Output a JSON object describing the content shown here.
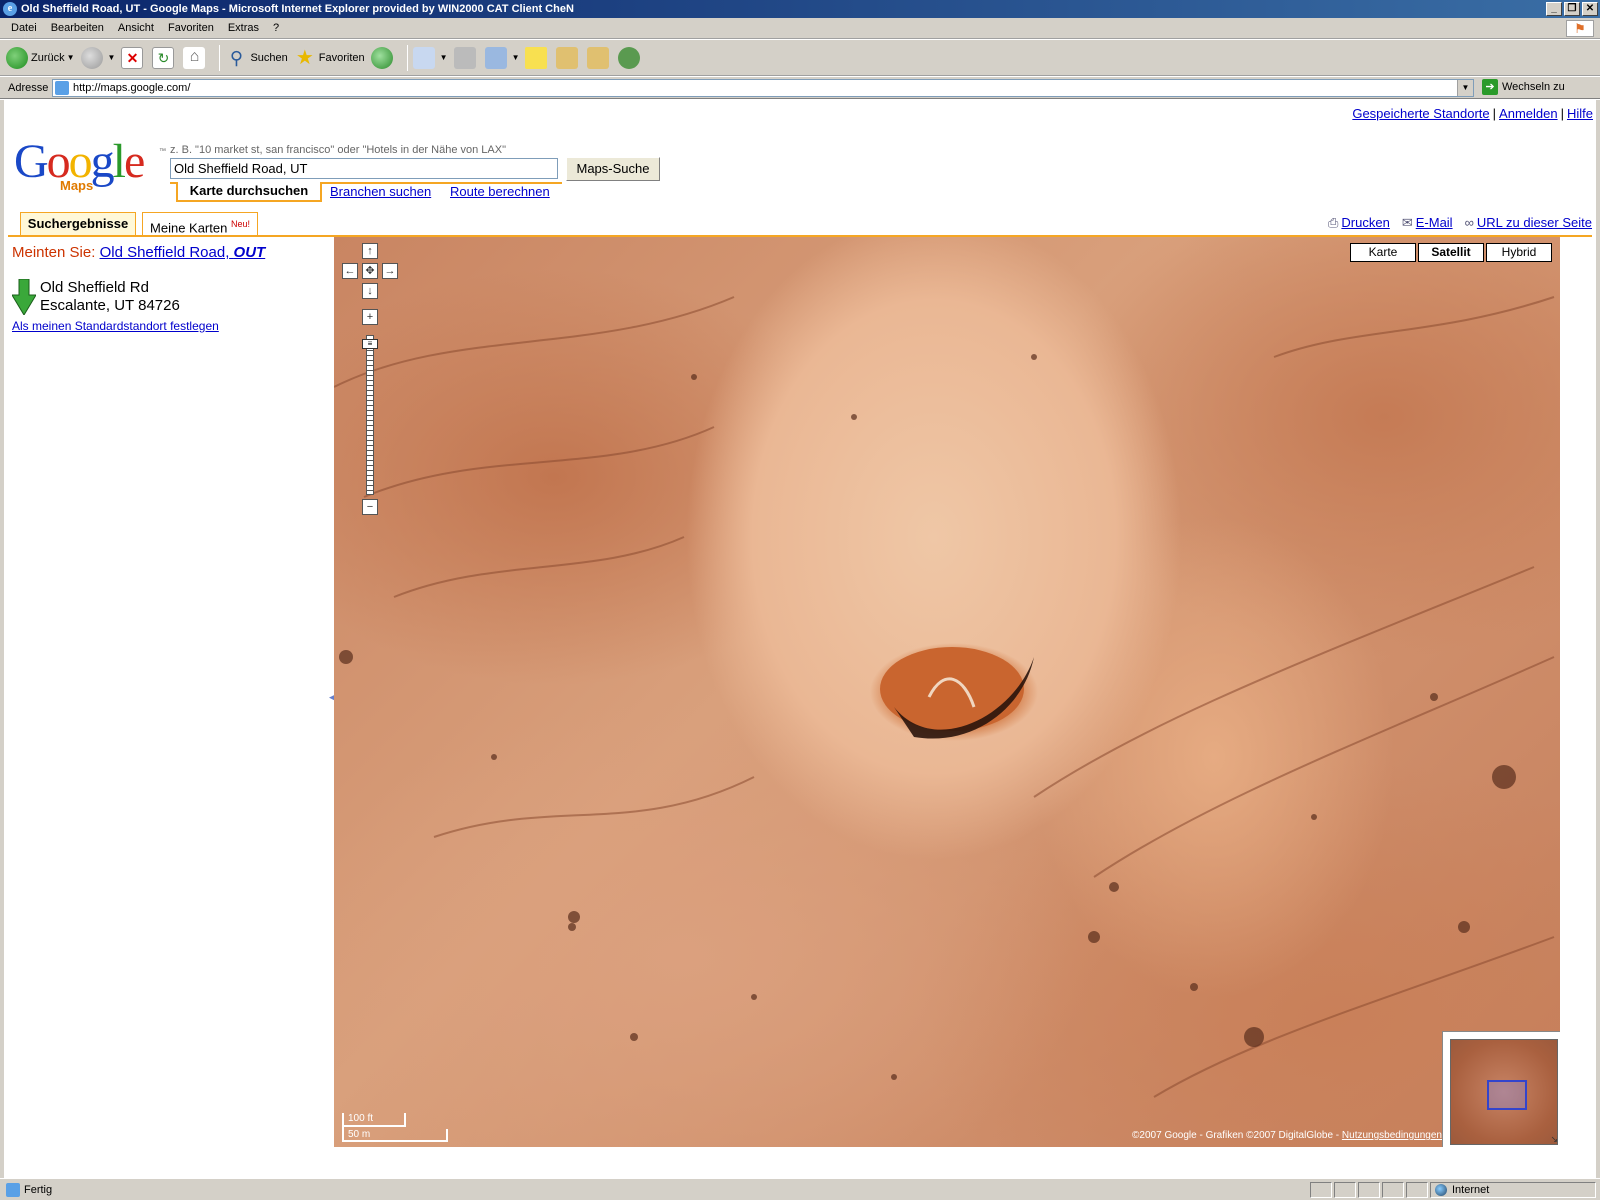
{
  "window": {
    "title": "Old Sheffield Road, UT - Google Maps - Microsoft Internet Explorer provided by WIN2000 CAT Client CheN"
  },
  "menu": [
    "Datei",
    "Bearbeiten",
    "Ansicht",
    "Favoriten",
    "Extras",
    "?"
  ],
  "toolbar": {
    "back_label": "Zurück",
    "search_label": "Suchen",
    "favorites_label": "Favoriten"
  },
  "address": {
    "label": "Adresse",
    "url": "http://maps.google.com/",
    "go_label": "Wechseln zu"
  },
  "toplinks": {
    "saved": "Gespeicherte Standorte",
    "signin": "Anmelden",
    "help": "Hilfe"
  },
  "logo": {
    "text": "Google",
    "sub": "Maps"
  },
  "search": {
    "hint": "z. B. \"10 market st, san francisco\" oder \"Hotels in der Nähe von LAX\"",
    "query": "Old Sheffield Road, UT",
    "button": "Maps-Suche",
    "tab_active": "Karte durchsuchen",
    "tab_business": "Branchen suchen",
    "tab_route": "Route berechnen"
  },
  "panel_tabs": {
    "results": "Suchergebnisse",
    "mymaps": "Meine Karten",
    "new_badge": "Neu!"
  },
  "actions": {
    "print": "Drucken",
    "email": "E-Mail",
    "link": "URL zu dieser Seite"
  },
  "results": {
    "didyoumean_prefix": "Meinten Sie:",
    "suggestion": "Old Sheffield Road,",
    "suggestion_bold": "OUT",
    "address_line1": "Old Sheffield Rd",
    "address_line2": "Escalante, UT 84726",
    "set_default": "Als meinen Standardstandort festlegen"
  },
  "map": {
    "types": [
      "Karte",
      "Satellit",
      "Hybrid"
    ],
    "selected_type": "Satellit",
    "scale_ft": "100 ft",
    "scale_m": "50 m",
    "copyright": "©2007 Google - Grafiken ©2007 DigitalGlobe -",
    "terms": "Nutzungsbedingungen"
  },
  "status": {
    "text": "Fertig",
    "zone": "Internet"
  }
}
